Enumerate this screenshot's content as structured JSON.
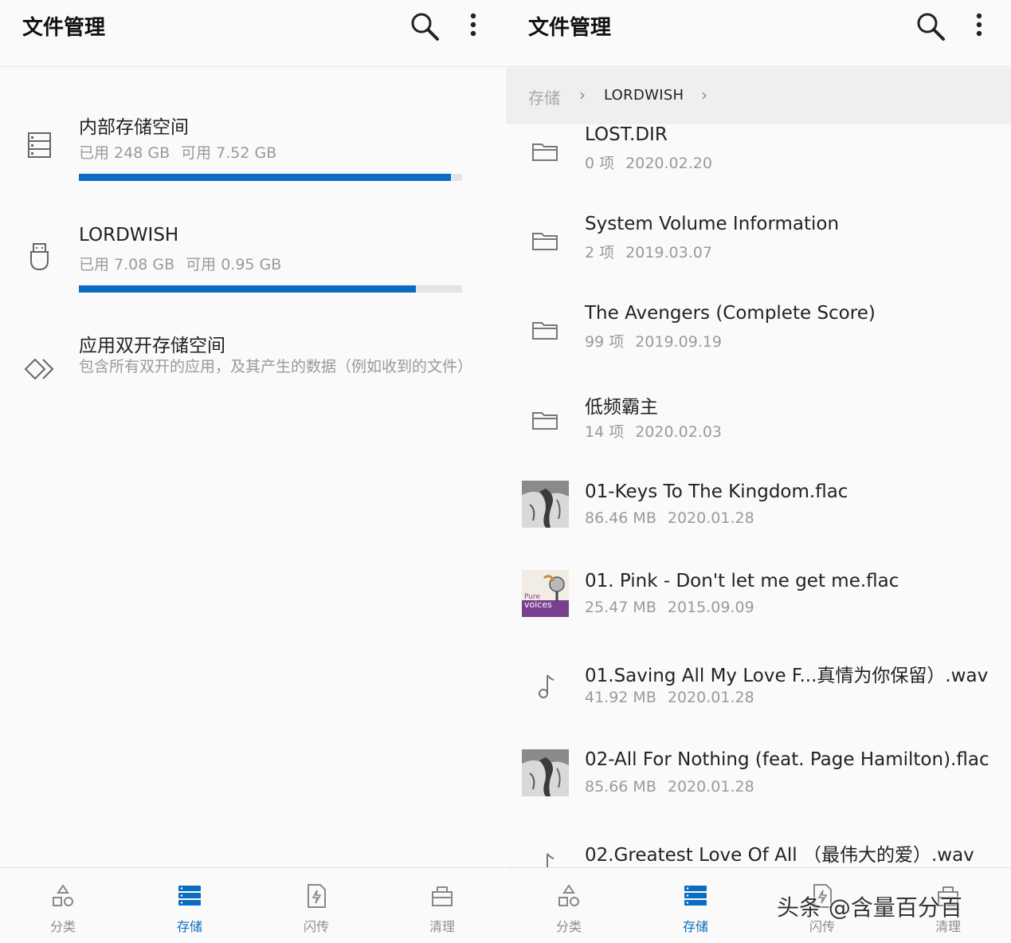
{
  "left": {
    "title": "文件管理",
    "storages": [
      {
        "name": "内部存储空间",
        "used": "已用 248 GB",
        "free": "可用 7.52 GB",
        "usage_fraction": 0.97
      },
      {
        "name": "LORDWISH",
        "used": "已用 7.08 GB",
        "free": "可用 0.95 GB",
        "usage_fraction": 0.88
      }
    ],
    "dual": {
      "name": "应用双开存储空间",
      "description": "包含所有双开的应用，及其产生的数据（例如收到的文件）"
    }
  },
  "right": {
    "title": "文件管理",
    "breadcrumb": {
      "root": "存储",
      "current": "LORDWISH"
    },
    "files": [
      {
        "name": "LOST.DIR",
        "count": "0 项",
        "date": "2020.02.20",
        "icon": "folder-icon"
      },
      {
        "name": "System Volume Information",
        "count": "2 项",
        "date": "2019.03.07",
        "icon": "folder-icon"
      },
      {
        "name": "The Avengers (Complete Score)",
        "count": "99 项",
        "date": "2019.09.19",
        "icon": "folder-icon"
      },
      {
        "name": "低频霸主",
        "count": "14 项",
        "date": "2020.02.03",
        "icon": "folder-icon"
      },
      {
        "name": "01-Keys To The Kingdom.flac",
        "count": "86.46 MB",
        "date": "2020.01.28",
        "icon": "album-art-thumbnail"
      },
      {
        "name": "01. Pink - Don't let me get me.flac",
        "count": "25.47 MB",
        "date": "2015.09.09",
        "icon": "album-art-thumbnail"
      },
      {
        "name": "01.Saving All My Love F...真情为你保留）.wav",
        "count": "41.92 MB",
        "date": "2020.01.28",
        "icon": "music-note-icon"
      },
      {
        "name": "02-All For Nothing (feat. Page Hamilton).flac",
        "count": "85.66 MB",
        "date": "2020.01.28",
        "icon": "album-art-thumbnail"
      },
      {
        "name": "02.Greatest Love Of All （最伟大的爱）.wav",
        "count": "",
        "date": "",
        "icon": "music-note-icon"
      }
    ],
    "thumb_text": {
      "pure": "Pure",
      "voices": "voices"
    }
  },
  "nav": {
    "items": [
      {
        "label": "分类",
        "icon": "category-shapes-icon"
      },
      {
        "label": "存储",
        "icon": "storage-icon"
      },
      {
        "label": "闪传",
        "icon": "flash-transfer-icon"
      },
      {
        "label": "清理",
        "icon": "cleanup-icon"
      }
    ],
    "active": "存储"
  },
  "watermark": "头条 @含量百分百",
  "colors": {
    "accent": "#0b6dc2",
    "muted": "#9a9a9a",
    "background": "#fafafa",
    "breadcrumb_bg": "#efefef"
  }
}
